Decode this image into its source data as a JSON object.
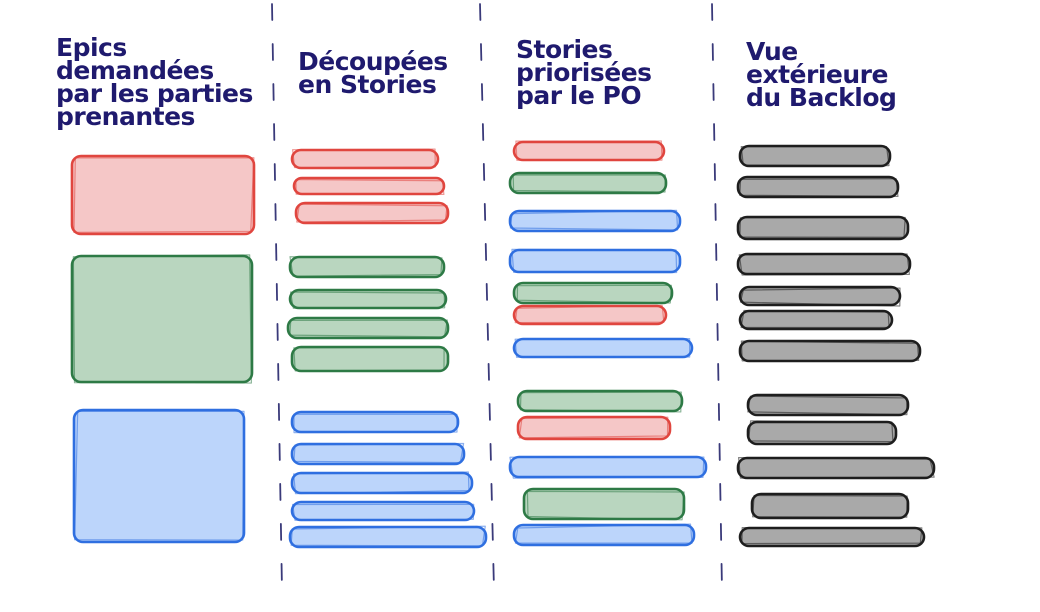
{
  "colors": {
    "ink": "#1f1a6e",
    "red_fill": "#f5c7c7",
    "red_stroke": "#e0463f",
    "green_fill": "#b9d6bf",
    "green_stroke": "#2e7a46",
    "blue_fill": "#bcd5fb",
    "blue_stroke": "#2f6fe0",
    "gray_fill": "#a9a9a9",
    "gray_stroke": "#1e1e1e",
    "divider": "#3a3a7a"
  },
  "columns": [
    {
      "title_lines": [
        "Epics",
        "demandées",
        "par les parties",
        "prenantes"
      ],
      "items": [
        "red-epic",
        "green-epic",
        "blue-epic"
      ]
    },
    {
      "title_lines": [
        "Découpées",
        "en Stories"
      ],
      "items": [
        "red",
        "red",
        "red",
        "green",
        "green",
        "green",
        "green",
        "blue",
        "blue",
        "blue",
        "blue",
        "blue"
      ]
    },
    {
      "title_lines": [
        "Stories",
        "priorisées",
        "par le PO"
      ],
      "items": [
        "red",
        "green",
        "blue",
        "blue",
        "green",
        "red",
        "blue",
        "green",
        "red",
        "blue",
        "green",
        "blue"
      ]
    },
    {
      "title_lines": [
        "Vue",
        "extérieure",
        "du Backlog"
      ],
      "items": [
        "gray",
        "gray",
        "gray",
        "gray",
        "gray",
        "gray",
        "gray",
        "gray",
        "gray",
        "gray",
        "gray",
        "gray"
      ]
    }
  ]
}
